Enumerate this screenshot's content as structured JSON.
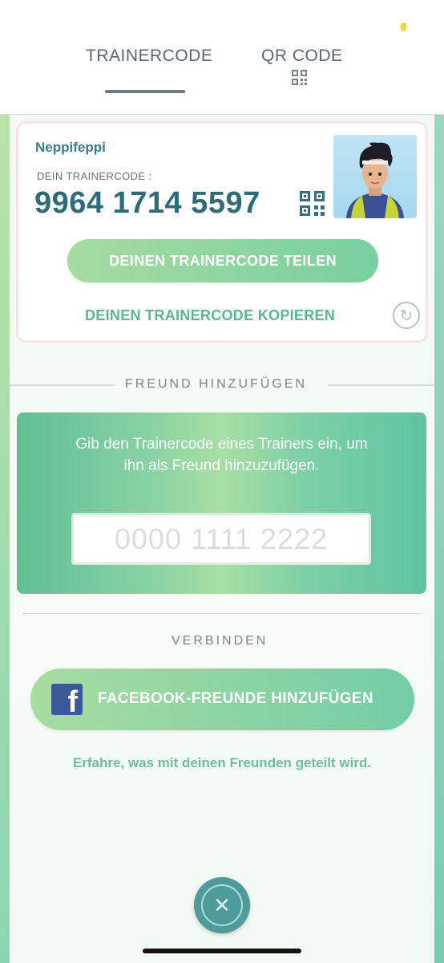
{
  "header": {
    "tabs": [
      {
        "label": "TRAINERCODE",
        "active": true
      },
      {
        "label": "QR CODE",
        "active": false
      }
    ]
  },
  "code_card": {
    "trainer_name": "Neppifeppi",
    "code_label": "DEIN TRAINERCODE :",
    "code_value": "9964 1714 5597",
    "share_label": "DEINEN TRAINERCODE TEILEN",
    "copy_label": "DEINEN TRAINERCODE KOPIEREN"
  },
  "add_friend": {
    "section_title": "FREUND HINZUFÜGEN",
    "instructions": "Gib den Trainercode eines Trainers ein, um ihn als Freund hinzuzufügen.",
    "input_value": "",
    "input_placeholder": "0000 1111 2222"
  },
  "connect": {
    "section_title": "VERBINDEN",
    "facebook_label": "FACEBOOK-FREUNDE HINZUFÜGEN",
    "info_link": "Erfahre, was mit deinen Freunden geteilt wird."
  },
  "colors": {
    "primary_teal": "#2e6c78",
    "accent_green": "#5cb790",
    "facebook_blue": "#3b5998"
  },
  "icons": {
    "qr": "qr-code-icon",
    "refresh": "refresh-icon",
    "facebook": "facebook-icon",
    "close": "close-icon"
  }
}
